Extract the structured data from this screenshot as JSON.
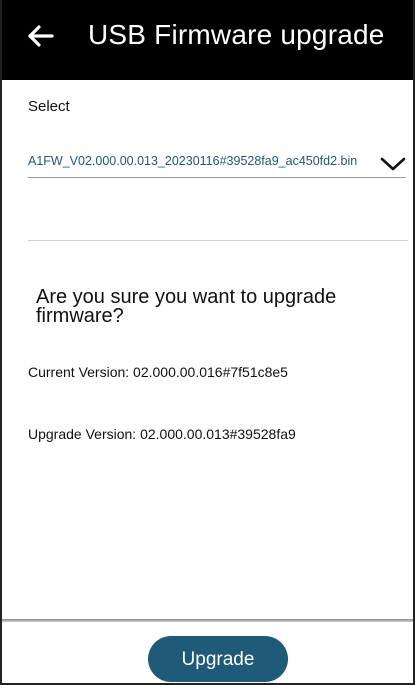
{
  "header": {
    "back_icon": "arrow-left-icon",
    "title": "USB Firmware upgrade"
  },
  "select": {
    "label": "Select",
    "value": "A1FW_V02.000.00.013_20230116#39528fa9_ac450fd2.bin",
    "arrow_icon": "chevron-down-icon"
  },
  "confirm": {
    "question": "Are you sure you want to upgrade firmware?",
    "current_version": "Current Version: 02.000.00.016#7f51c8e5",
    "upgrade_version": "Upgrade Version: 02.000.00.013#39528fa9"
  },
  "footer": {
    "upgrade_label": "Upgrade"
  },
  "colors": {
    "header_bg": "#000000",
    "accent": "#1f5a78",
    "dropdown_text": "#1e5a78"
  }
}
